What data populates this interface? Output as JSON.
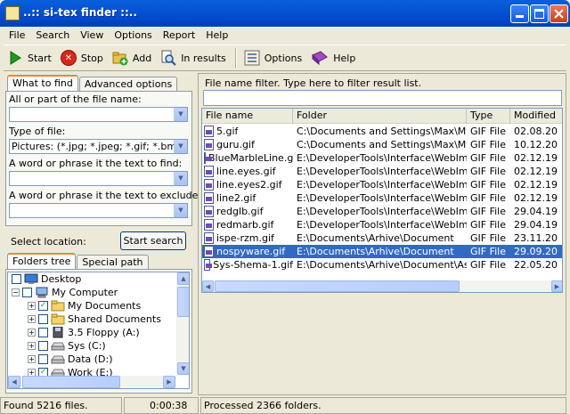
{
  "window": {
    "title": "..:: si-tex finder ::.."
  },
  "menu": [
    "File",
    "Search",
    "View",
    "Options",
    "Report",
    "Help"
  ],
  "toolbar": {
    "start": "Start",
    "stop": "Stop",
    "add": "Add",
    "in_results": "In results",
    "options": "Options",
    "help": "Help"
  },
  "left": {
    "tabs": [
      "What to find",
      "Advanced options"
    ],
    "file_name_label": "All or part of the file name:",
    "file_name_value": "",
    "type_label": "Type of file:",
    "type_value": "Pictures: (*.jpg; *.jpeg; *.gif; *.bmp; *.p",
    "phrase_label": "A word or phrase it the text to find:",
    "phrase_value": "",
    "exclude_label": "A word or phrase it the text to exclude:",
    "exclude_value": "",
    "location_label": "Select location:",
    "start_search": "Start search",
    "tree_tabs": [
      "Folders tree",
      "Special path"
    ],
    "tree": [
      {
        "label": "Desktop",
        "expander": "",
        "checked": false,
        "icon": "desktop-icon"
      },
      {
        "label": "My Computer",
        "expander": "−",
        "checked": false,
        "icon": "computer-icon"
      },
      {
        "label": "My Documents",
        "expander": "+",
        "checked": true,
        "icon": "folder-icon"
      },
      {
        "label": "Shared Documents",
        "expander": "+",
        "checked": false,
        "icon": "folder-icon"
      },
      {
        "label": "3.5 Floppy (A:)",
        "expander": "+",
        "checked": false,
        "icon": "floppy-icon"
      },
      {
        "label": "Sys (C:)",
        "expander": "+",
        "checked": false,
        "icon": "drive-icon"
      },
      {
        "label": "Data (D:)",
        "expander": "+",
        "checked": false,
        "icon": "drive-icon"
      },
      {
        "label": "Work (E:)",
        "expander": "+",
        "checked": true,
        "icon": "drive-icon"
      }
    ]
  },
  "right": {
    "filter_label": "File name filter. Type here to filter result list.",
    "filter_value": "",
    "columns": [
      "File name",
      "Folder",
      "Type",
      "Modified"
    ],
    "rows": [
      {
        "name": "5.gif",
        "folder": "C:\\Documents and Settings\\Max\\My Do...",
        "type": "GIF File",
        "modified": "02.08.20"
      },
      {
        "name": "guru.gif",
        "folder": "C:\\Documents and Settings\\Max\\My Do...",
        "type": "GIF File",
        "modified": "10.12.20"
      },
      {
        "name": "BlueMarbleLine.gif",
        "folder": "E:\\DeveloperTools\\Interface\\WebImg",
        "type": "GIF File",
        "modified": "02.12.19"
      },
      {
        "name": "line.eyes.gif",
        "folder": "E:\\DeveloperTools\\Interface\\WebImg",
        "type": "GIF File",
        "modified": "02.12.19"
      },
      {
        "name": "line.eyes2.gif",
        "folder": "E:\\DeveloperTools\\Interface\\WebImg",
        "type": "GIF File",
        "modified": "02.12.19"
      },
      {
        "name": "line2.gif",
        "folder": "E:\\DeveloperTools\\Interface\\WebImg",
        "type": "GIF File",
        "modified": "02.12.19"
      },
      {
        "name": "redglb.gif",
        "folder": "E:\\DeveloperTools\\Interface\\WebImg",
        "type": "GIF File",
        "modified": "29.04.19"
      },
      {
        "name": "redmarb.gif",
        "folder": "E:\\DeveloperTools\\Interface\\WebImg",
        "type": "GIF File",
        "modified": "29.04.19"
      },
      {
        "name": "ispe-rzm.gif",
        "folder": "E:\\Documents\\Arhive\\Document",
        "type": "GIF File",
        "modified": "23.11.20"
      },
      {
        "name": "nospyware.gif",
        "folder": "E:\\Documents\\Arhive\\Document",
        "type": "GIF File",
        "modified": "29.09.20"
      },
      {
        "name": "Sys-Shema-1.gif",
        "folder": "E:\\Documents\\Arhive\\Document\\Asad",
        "type": "GIF File",
        "modified": "22.05.20"
      }
    ],
    "selected_row": 9
  },
  "status": {
    "found": "Found 5216 files.",
    "time": "0:00:38",
    "processed": "Processed 2366 folders."
  },
  "colors": {
    "selection": "#316ac5",
    "title_bar": "#0453d4",
    "face": "#ece9d8"
  }
}
